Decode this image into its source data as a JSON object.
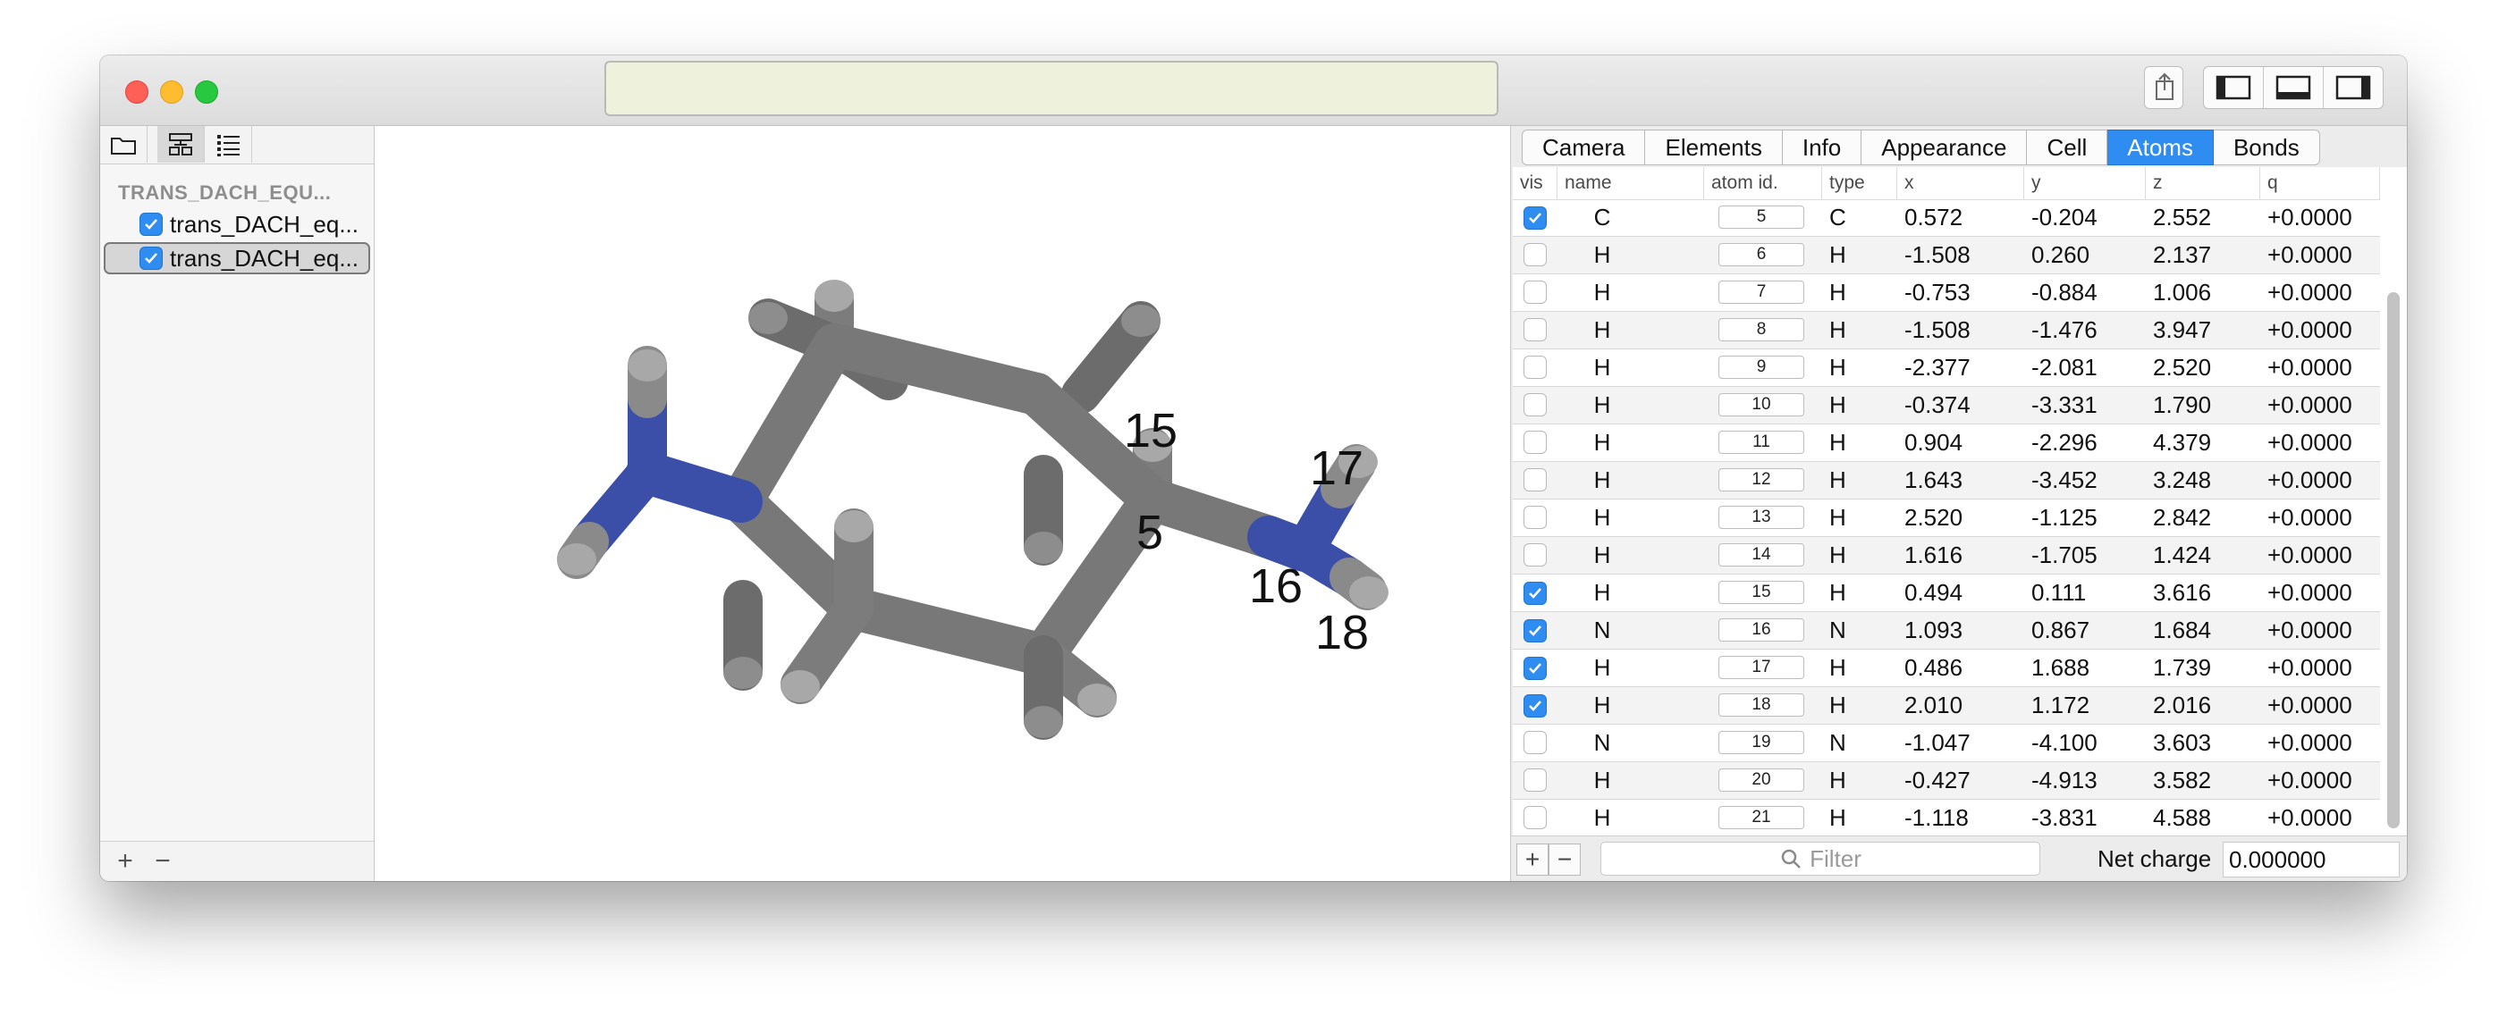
{
  "address_bar": {
    "value": ""
  },
  "sidebar": {
    "tabs": [
      "folder-icon",
      "hierarchy-icon",
      "list-icon"
    ],
    "section_title": "TRANS_DACH_EQU...",
    "items": [
      {
        "label": "trans_DACH_eq...",
        "checked": true,
        "selected": false
      },
      {
        "label": "trans_DACH_eq...",
        "checked": true,
        "selected": true
      }
    ],
    "add": "+",
    "remove": "−"
  },
  "viewer": {
    "atom_labels": [
      "15",
      "5",
      "17",
      "16",
      "18"
    ],
    "colors": {
      "carbon": "#7a7a7a",
      "nitrogen": "#3b4fa8",
      "hydrogen": "#8f8f8f"
    }
  },
  "inspector": {
    "tabs": [
      "Camera",
      "Elements",
      "Info",
      "Appearance",
      "Cell",
      "Atoms",
      "Bonds"
    ],
    "active_tab": "Atoms",
    "columns": [
      "vis",
      "name",
      "atom id.",
      "type",
      "x",
      "y",
      "z",
      "q"
    ],
    "rows": [
      {
        "vis": true,
        "name": "C",
        "id": "5",
        "type": "C",
        "x": "0.572",
        "y": "-0.204",
        "z": "2.552",
        "q": "+0.0000"
      },
      {
        "vis": false,
        "name": "H",
        "id": "6",
        "type": "H",
        "x": "-1.508",
        "y": "0.260",
        "z": "2.137",
        "q": "+0.0000"
      },
      {
        "vis": false,
        "name": "H",
        "id": "7",
        "type": "H",
        "x": "-0.753",
        "y": "-0.884",
        "z": "1.006",
        "q": "+0.0000"
      },
      {
        "vis": false,
        "name": "H",
        "id": "8",
        "type": "H",
        "x": "-1.508",
        "y": "-1.476",
        "z": "3.947",
        "q": "+0.0000"
      },
      {
        "vis": false,
        "name": "H",
        "id": "9",
        "type": "H",
        "x": "-2.377",
        "y": "-2.081",
        "z": "2.520",
        "q": "+0.0000"
      },
      {
        "vis": false,
        "name": "H",
        "id": "10",
        "type": "H",
        "x": "-0.374",
        "y": "-3.331",
        "z": "1.790",
        "q": "+0.0000"
      },
      {
        "vis": false,
        "name": "H",
        "id": "11",
        "type": "H",
        "x": "0.904",
        "y": "-2.296",
        "z": "4.379",
        "q": "+0.0000"
      },
      {
        "vis": false,
        "name": "H",
        "id": "12",
        "type": "H",
        "x": "1.643",
        "y": "-3.452",
        "z": "3.248",
        "q": "+0.0000"
      },
      {
        "vis": false,
        "name": "H",
        "id": "13",
        "type": "H",
        "x": "2.520",
        "y": "-1.125",
        "z": "2.842",
        "q": "+0.0000"
      },
      {
        "vis": false,
        "name": "H",
        "id": "14",
        "type": "H",
        "x": "1.616",
        "y": "-1.705",
        "z": "1.424",
        "q": "+0.0000"
      },
      {
        "vis": true,
        "name": "H",
        "id": "15",
        "type": "H",
        "x": "0.494",
        "y": "0.111",
        "z": "3.616",
        "q": "+0.0000"
      },
      {
        "vis": true,
        "name": "N",
        "id": "16",
        "type": "N",
        "x": "1.093",
        "y": "0.867",
        "z": "1.684",
        "q": "+0.0000"
      },
      {
        "vis": true,
        "name": "H",
        "id": "17",
        "type": "H",
        "x": "0.486",
        "y": "1.688",
        "z": "1.739",
        "q": "+0.0000"
      },
      {
        "vis": true,
        "name": "H",
        "id": "18",
        "type": "H",
        "x": "2.010",
        "y": "1.172",
        "z": "2.016",
        "q": "+0.0000"
      },
      {
        "vis": false,
        "name": "N",
        "id": "19",
        "type": "N",
        "x": "-1.047",
        "y": "-4.100",
        "z": "3.603",
        "q": "+0.0000"
      },
      {
        "vis": false,
        "name": "H",
        "id": "20",
        "type": "H",
        "x": "-0.427",
        "y": "-4.913",
        "z": "3.582",
        "q": "+0.0000"
      },
      {
        "vis": false,
        "name": "H",
        "id": "21",
        "type": "H",
        "x": "-1.118",
        "y": "-3.831",
        "z": "4.588",
        "q": "+0.0000"
      }
    ],
    "footer": {
      "add": "+",
      "remove": "−",
      "filter_placeholder": "Filter",
      "net_charge_label": "Net charge",
      "net_charge_value": "0.000000"
    },
    "accent": "#2f8cf0"
  }
}
